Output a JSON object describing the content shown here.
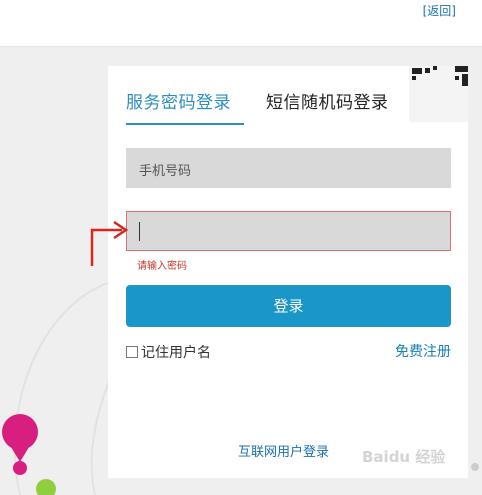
{
  "header": {
    "back_label": "[返回]"
  },
  "login": {
    "tabs": [
      {
        "label": "服务密码登录",
        "active": true
      },
      {
        "label": "短信随机码登录",
        "active": false
      }
    ],
    "phone_placeholder": "手机号码",
    "password_error": "请输入密码",
    "login_button": "登录",
    "remember_label": "记住用户名",
    "remember_checked": false,
    "register_link": "免费注册",
    "internet_login_link": "互联网用户登录"
  },
  "watermark": {
    "text": "Baidu 经验"
  },
  "colors": {
    "accent": "#2a8fbf",
    "button": "#1a96c9",
    "error": "#c0392b",
    "annotation_arrow": "#d9261c"
  }
}
